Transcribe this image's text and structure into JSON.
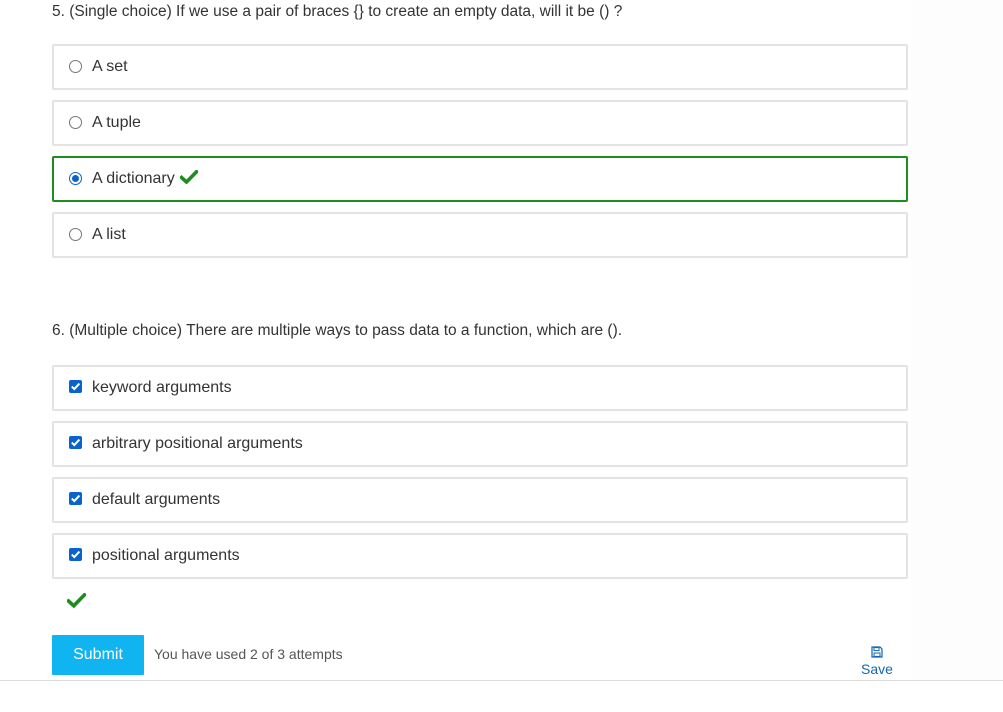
{
  "question5": {
    "text": "5. (Single choice) If we use a pair of braces {} to create an empty data, will it be () ?",
    "type": "single",
    "options": [
      {
        "label": "A set",
        "selected": false,
        "correct": false
      },
      {
        "label": "A tuple",
        "selected": false,
        "correct": false
      },
      {
        "label": "A dictionary",
        "selected": true,
        "correct": true
      },
      {
        "label": "A list",
        "selected": false,
        "correct": false
      }
    ]
  },
  "question6": {
    "text": "6. (Multiple choice) There are multiple ways to pass data to a function, which are ().",
    "type": "multiple",
    "options": [
      {
        "label": "keyword arguments",
        "checked": true
      },
      {
        "label": "arbitrary positional arguments",
        "checked": true
      },
      {
        "label": "default arguments",
        "checked": true
      },
      {
        "label": "positional arguments",
        "checked": true
      }
    ],
    "result_icon": "checkmark-icon"
  },
  "footer": {
    "submit_label": "Submit",
    "attempts_text": "You have used 2 of 3 attempts",
    "save_label": "Save",
    "save_icon": "floppy-disk-icon"
  },
  "colors": {
    "correct_green": "#1e8c1e",
    "check_blue": "#0a64c8",
    "submit_blue": "#0fb4f0",
    "link_blue": "#1066b0",
    "option_border": "#e3e3e3"
  }
}
